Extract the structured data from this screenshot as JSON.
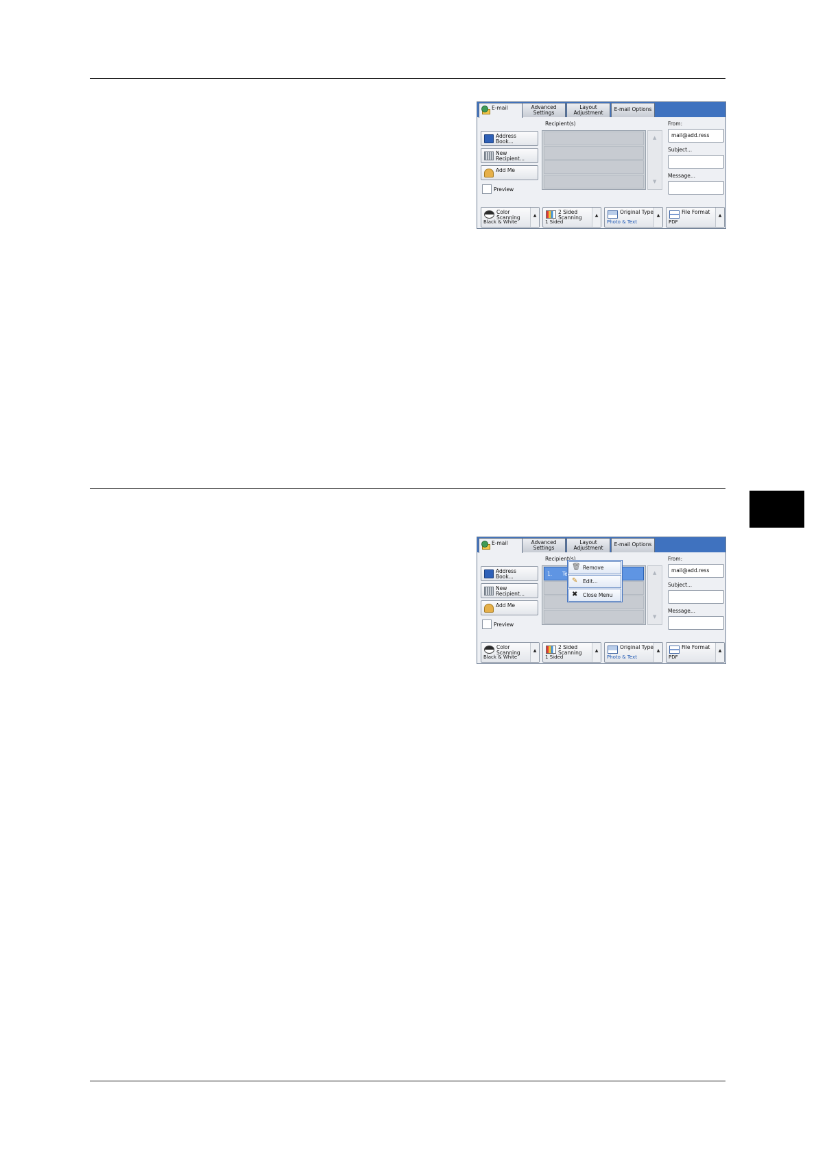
{
  "screens": [
    {
      "tabs": {
        "email": "E-mail",
        "advanced": "Advanced Settings",
        "layout": "Layout Adjustment",
        "options": "E-mail Options"
      },
      "recipients_label": "Recipient(s)",
      "left_buttons": {
        "address_book": "Address Book...",
        "new_recipient": "New Recipient...",
        "add_me": "Add Me"
      },
      "preview_label": "Preview",
      "right": {
        "from_label": "From:",
        "from_value": "mail@add.ress",
        "subject_label": "Subject...",
        "message_label": "Message..."
      },
      "bottom": {
        "color_title": "Color Scanning",
        "color_value": "Black & White",
        "sided_title": "2 Sided Scanning",
        "sided_value": "1 Sided",
        "orig_title": "Original Type",
        "orig_value": "Photo & Text",
        "format_title": "File Format",
        "format_value": "PDF"
      }
    },
    {
      "tabs": {
        "email": "E-mail",
        "advanced": "Advanced Settings",
        "layout": "Layout Adjustment",
        "options": "E-mail Options"
      },
      "recipients_label": "Recipient(s)",
      "recipient_row": "1.",
      "recipient_partial": "Te",
      "left_buttons": {
        "address_book": "Address Book...",
        "new_recipient": "New Recipient...",
        "add_me": "Add Me"
      },
      "preview_label": "Preview",
      "right": {
        "from_label": "From:",
        "from_value": "mail@add.ress",
        "subject_label": "Subject...",
        "message_label": "Message..."
      },
      "bottom": {
        "color_title": "Color Scanning",
        "color_value": "Black & White",
        "sided_title": "2 Sided Scanning",
        "sided_value": "1 Sided",
        "orig_title": "Original Type",
        "orig_value": "Photo & Text",
        "format_title": "File Format",
        "format_value": "PDF"
      },
      "context_menu": {
        "remove": "Remove",
        "edit": "Edit...",
        "close": "Close Menu"
      }
    }
  ],
  "icons": [
    "globe-envelope-icon",
    "address-book-icon",
    "keyboard-icon",
    "person-icon",
    "color-scanning-icon",
    "two-sided-icon",
    "original-type-icon",
    "file-format-icon",
    "trash-icon",
    "edit-icon",
    "close-icon"
  ]
}
